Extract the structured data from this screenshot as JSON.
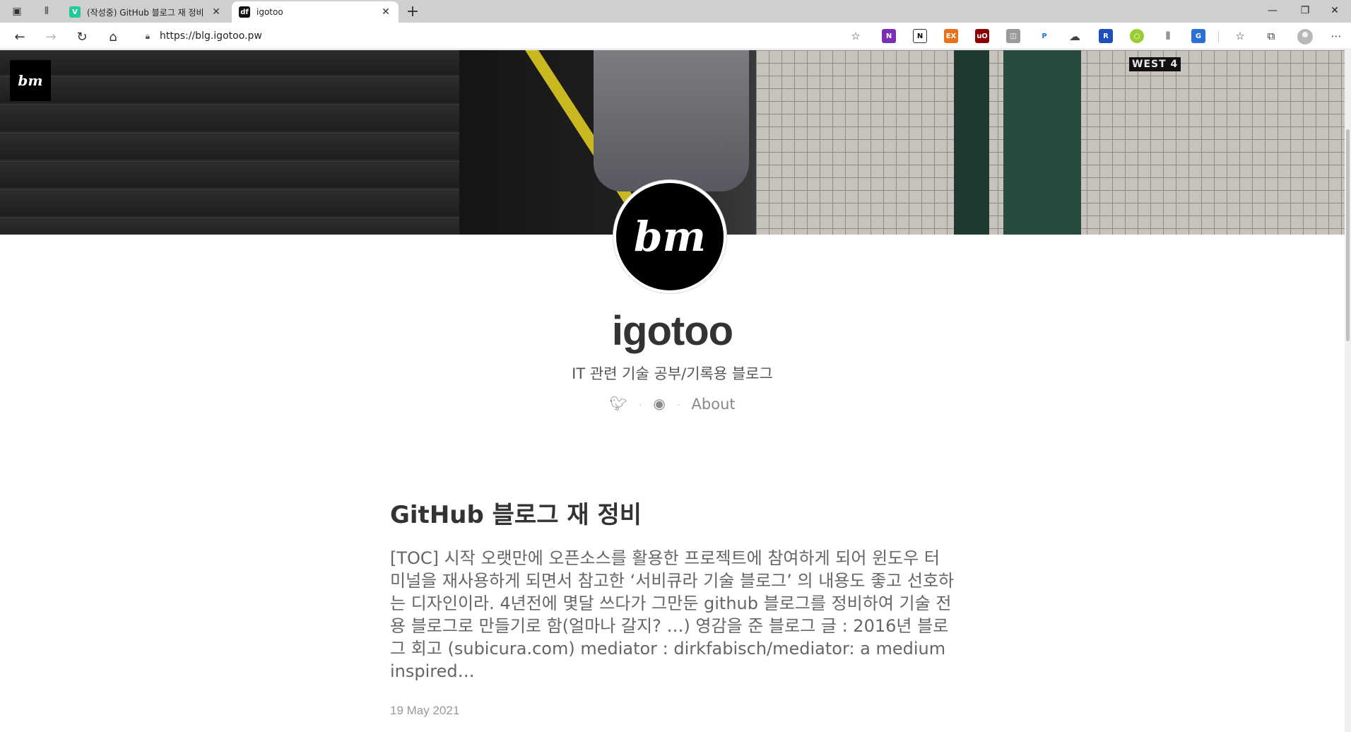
{
  "browser": {
    "tabs": [
      {
        "title": "(작성중) GitHub 블로그 재 정비",
        "active": false
      },
      {
        "title": "igotoo",
        "active": true
      }
    ],
    "url": "https://blg.igotoo.pw"
  },
  "page": {
    "hero_logo": "bm",
    "hero_sign": "WEST 4",
    "avatar_text": "bm",
    "site_title": "igotoo",
    "site_description": "IT 관련 기술 공부/기록용 블로그",
    "social": {
      "twitter_icon": "twitter-icon",
      "github_icon": "github-icon",
      "about_label": "About"
    },
    "post": {
      "title": "GitHub 블로그 재 정비",
      "excerpt": "[TOC] 시작 오랫만에 오픈소스를 활용한 프로젝트에 참여하게 되어 윈도우 터미널을 재사용하게 되면서 참고한 ‘서비큐라 기술 블로그’ 의 내용도 좋고 선호하는 디자인이라. 4년전에 몇달 쓰다가 그만둔 github 블로그를 정비하여 기술 전용 블로그로 만들기로 함(얼마나 갈지? …) 영감을 준 블로그 글 : 2016년 블로그 회고 (subicura.com) mediator : dirkfabisch/mediator: a medium inspired…",
      "date": "19 May 2021"
    }
  }
}
